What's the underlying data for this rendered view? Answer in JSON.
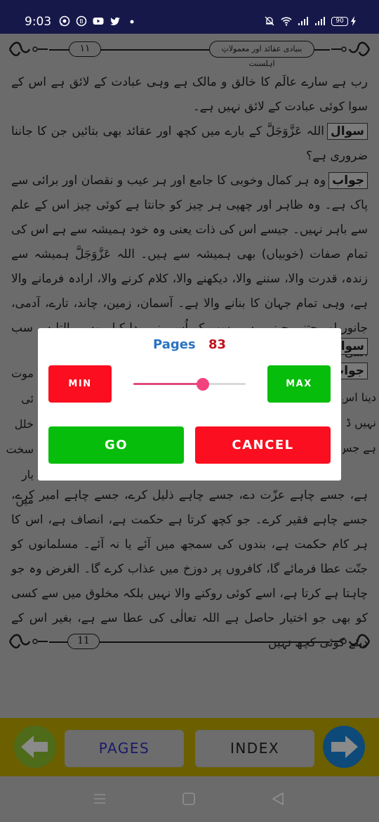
{
  "status_bar": {
    "time": "9:03",
    "left_icons": [
      "whatsapp-icon",
      "whatsapp-business-icon",
      "youtube-icon",
      "twitter-icon",
      "notification-dot-icon"
    ],
    "right_icons": [
      "mute-bell-icon",
      "wifi-icon",
      "signal-icon",
      "signal-icon"
    ],
    "battery": "90",
    "charging": true
  },
  "page": {
    "header": {
      "page_number": "١١",
      "book_title": "بنیادی عقائد اور معمولاتِ اہلسنت"
    },
    "paragraphs": [
      "رب ہے سارے عالَم کا خالق و مالک ہے وہی عبادت کے لائق ہے اس کے سوا کوئی عبادت کے لائق نہیں ہے۔",
      {
        "label": "سوال",
        "text": "اللہ عَزَّوَجَلَّ کے بارے میں کچھ اور عقائد بھی بتائیں جن کا جاننا ضروری ہے؟"
      },
      {
        "label": "جواب",
        "text": "وہ ہر کمال وخوبی کا جامع اور ہر عیب و نقصان اور برائی سے پاک ہے۔ وہ ظاہر اور چھپی ہر چیز کو جانتا ہے کوئی چیز اس کے علم سے باہر نہیں۔ جیسے اس کی ذات یعنی وہ خود ہمیشہ سے ہے اس کی تمام صفات (خوبیاں) بھی ہمیشہ سے ہیں۔ اللہ عَزَّوَجَلَّ ہمیشہ سے زندہ، قدرت والا، سننے والا، دیکھنے والا، کلام کرنے والا، ارادہ فرمانے والا ہے، وہی تمام جہان کا بنانے والا ہے۔ آسمان، زمین، چاند، تارے، آدمی، جانور اور جتنی چیزیں ہیں سب کو اُسی نے پیدا کیا۔ وہی پالتا ہے سب اُسی کے محتاج ہیں۔"
      }
    ],
    "partial_lines_behind_dialog": {
      "label_question": "سوال",
      "label_answer": "جواب",
      "right_fragments": [
        "موت",
        "ئی خلل",
        "سخت",
        "یار میں"
      ],
      "left_fragments": [
        "دینا اس",
        "نہیں ڈ",
        "ہے جس"
      ]
    },
    "lower_paragraph": "ہے، جسے چاہے عزّت دے، جسے چاہے ذلیل کرے، جسے چاہے امیر کرے، جسے چاہے فقیر کرے۔ جو کچھ کرتا ہے حکمت ہے، انصاف ہے، اس کا ہر کام حکمت ہے، بندوں کی سمجھ میں آئے یا نہ آئے۔ مسلمانوں کو جنّت عطا فرمائے گا، کافروں پر دوزخ میں عذاب کرے گا۔ الغرض وہ جو چاہتا ہے کرتا ہے، اسے کوئی روکنے والا نہیں بلکہ مخلوق میں سے کسی کو بھی جو اختیار حاصل ہے اللہ تعالٰی کی عطا سے ہے، بغیر اس کے دیئے کوئی کچھ نہیں",
    "footer_page_number": "11"
  },
  "dialog": {
    "title_label": "Pages",
    "page_value": "83",
    "min_label": "MIN",
    "max_label": "MAX",
    "go_label": "GO",
    "cancel_label": "CANCEL",
    "slider_fraction": 0.62,
    "colors": {
      "title": "#2a73c2",
      "value": "#c0121d",
      "red_button": "#fa0e1f",
      "green_button": "#05bd0a",
      "slider_accent": "#f2437e"
    }
  },
  "bottom_bar": {
    "prev_icon": "arrow-left-icon",
    "pages_label": "PAGES",
    "index_label": "INDEX",
    "next_icon": "arrow-right-icon"
  },
  "system_nav": {
    "icons": [
      "menu-icon",
      "home-icon",
      "back-icon"
    ]
  }
}
